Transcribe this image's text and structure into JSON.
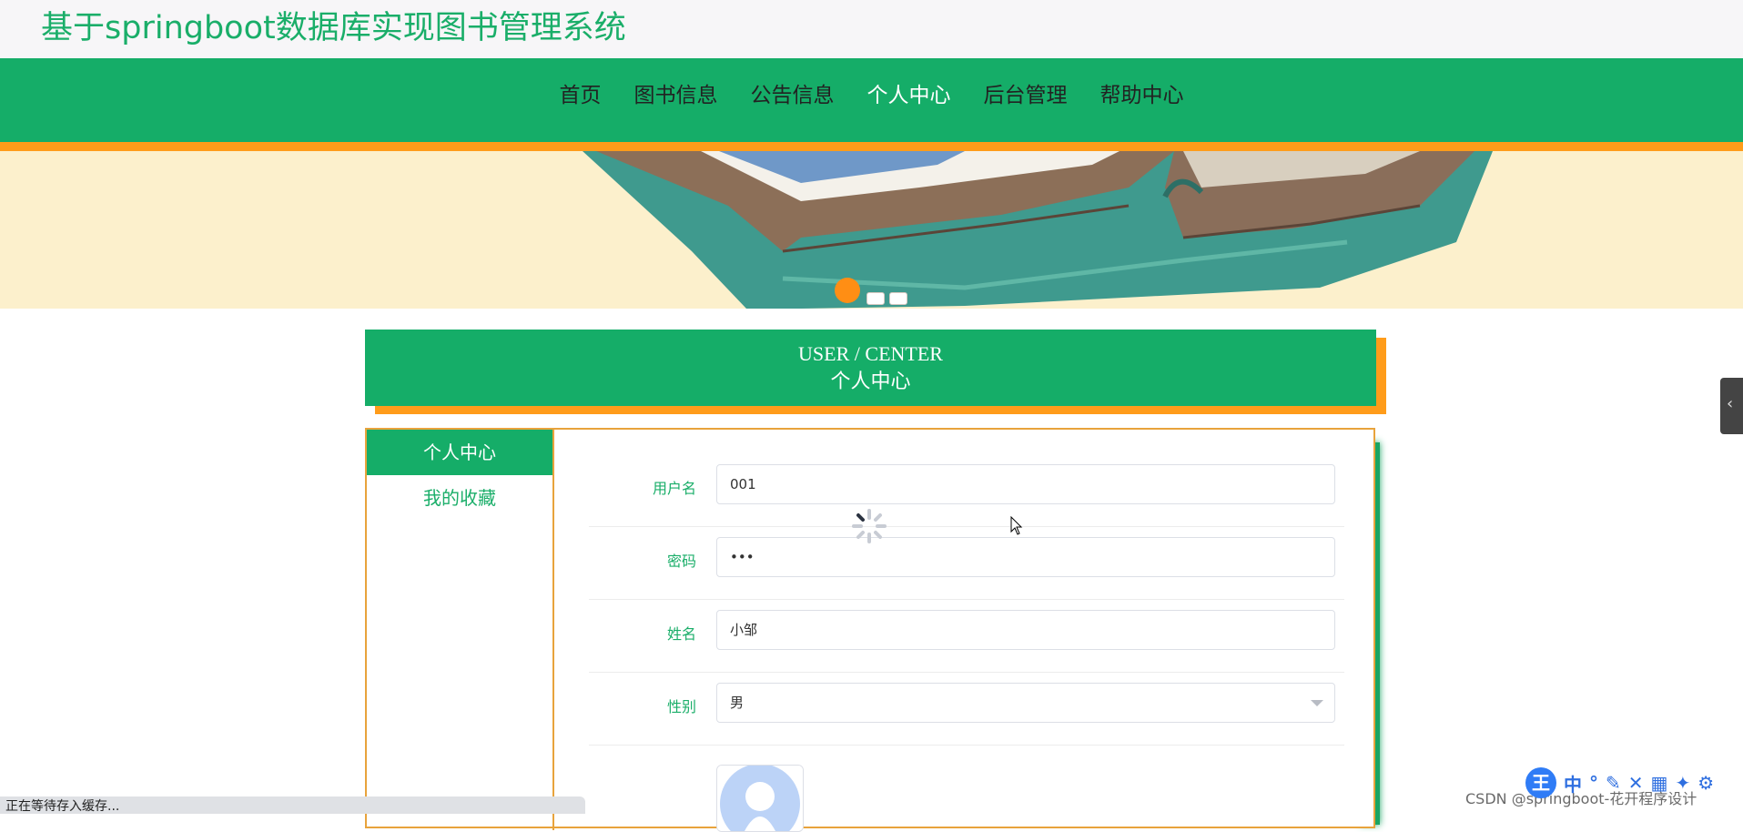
{
  "header": {
    "title": "基于springboot数据库实现图书管理系统"
  },
  "nav": {
    "items": [
      {
        "label": "首页"
      },
      {
        "label": "图书信息"
      },
      {
        "label": "公告信息"
      },
      {
        "label": "个人中心",
        "active": true
      },
      {
        "label": "后台管理"
      },
      {
        "label": "帮助中心"
      }
    ]
  },
  "banner": {
    "slides": 3,
    "active_slide": 1
  },
  "section": {
    "title_en": "USER / CENTER",
    "title_cn": "个人中心"
  },
  "side_menu": {
    "items": [
      {
        "label": "个人中心",
        "active": true
      },
      {
        "label": "我的收藏"
      }
    ]
  },
  "form": {
    "username": {
      "label": "用户名",
      "value": "001"
    },
    "password": {
      "label": "密码",
      "value": "•••"
    },
    "name": {
      "label": "姓名",
      "value": "小邹"
    },
    "gender": {
      "label": "性别",
      "value": "男"
    }
  },
  "status_bar": {
    "text": "正在等待存入缓存..."
  },
  "ime": {
    "logo": "王",
    "label": "中"
  },
  "watermark": {
    "text": "CSDN @springboot-花开程序设计"
  },
  "colors": {
    "green": "#15ad68",
    "orange": "#ff9c1a",
    "banner_bg": "#fcf0cc"
  }
}
